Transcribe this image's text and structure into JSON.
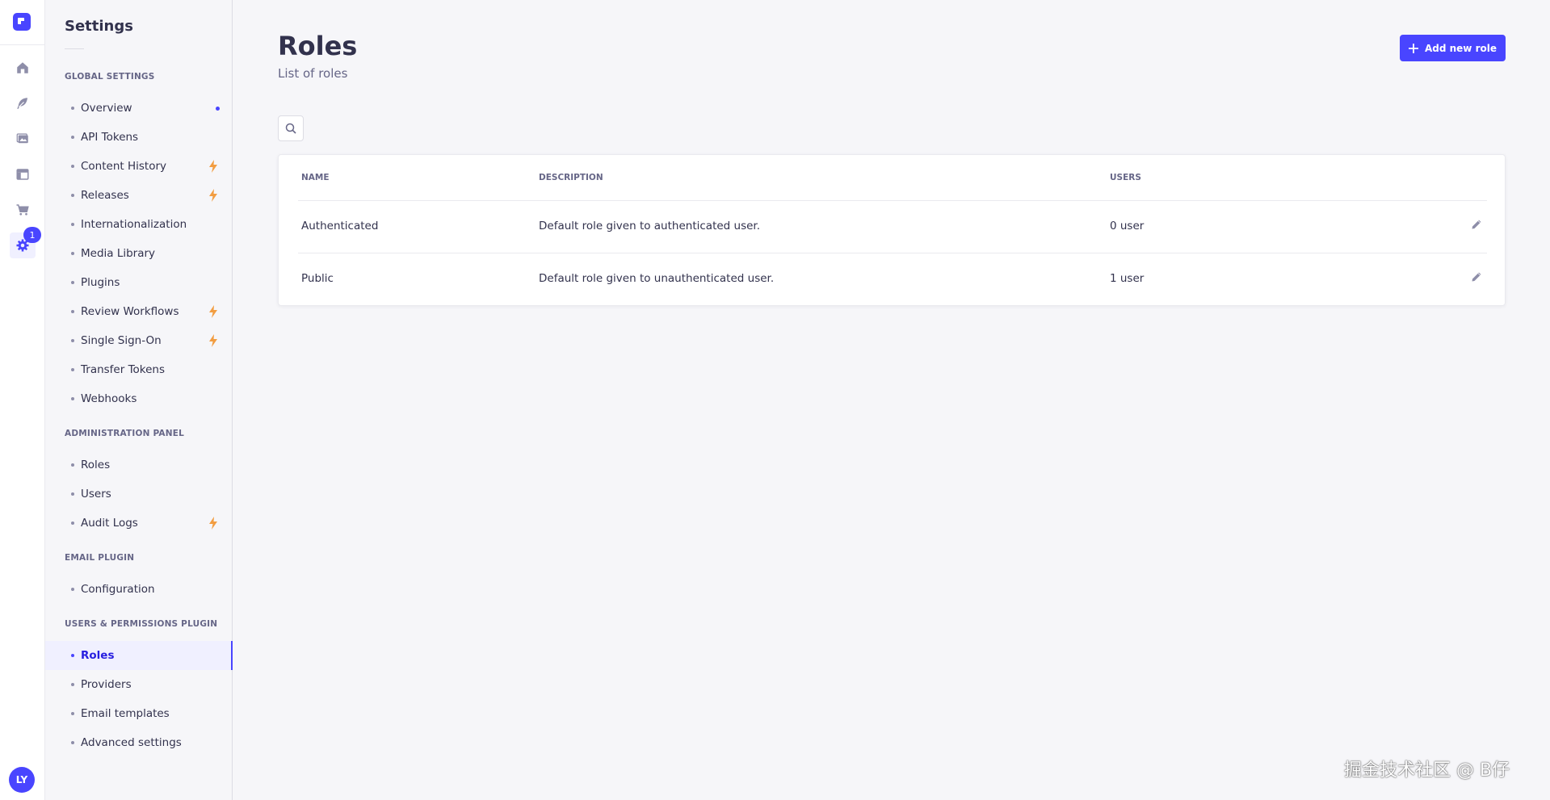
{
  "rail": {
    "badge": "1",
    "avatar": "LY",
    "icons": [
      "strapi-logo-icon",
      "home-icon",
      "feather-icon",
      "media-icon",
      "layout-icon",
      "cart-icon",
      "gear-icon"
    ]
  },
  "subnav": {
    "title": "Settings",
    "sections": [
      {
        "label": "GLOBAL SETTINGS",
        "items": [
          {
            "label": "Overview",
            "marker": "new-dot"
          },
          {
            "label": "API Tokens"
          },
          {
            "label": "Content History",
            "marker": "bolt"
          },
          {
            "label": "Releases",
            "marker": "bolt"
          },
          {
            "label": "Internationalization"
          },
          {
            "label": "Media Library"
          },
          {
            "label": "Plugins"
          },
          {
            "label": "Review Workflows",
            "marker": "bolt"
          },
          {
            "label": "Single Sign-On",
            "marker": "bolt"
          },
          {
            "label": "Transfer Tokens"
          },
          {
            "label": "Webhooks"
          }
        ]
      },
      {
        "label": "ADMINISTRATION PANEL",
        "items": [
          {
            "label": "Roles"
          },
          {
            "label": "Users"
          },
          {
            "label": "Audit Logs",
            "marker": "bolt"
          }
        ]
      },
      {
        "label": "EMAIL PLUGIN",
        "items": [
          {
            "label": "Configuration"
          }
        ]
      },
      {
        "label": "USERS & PERMISSIONS PLUGIN",
        "items": [
          {
            "label": "Roles",
            "active": true
          },
          {
            "label": "Providers"
          },
          {
            "label": "Email templates"
          },
          {
            "label": "Advanced settings"
          }
        ]
      }
    ]
  },
  "main": {
    "title": "Roles",
    "subtitle": "List of roles",
    "add_button_label": "Add new role",
    "table": {
      "headers": [
        "NAME",
        "DESCRIPTION",
        "USERS"
      ],
      "rows": [
        {
          "name": "Authenticated",
          "description": "Default role given to authenticated user.",
          "users": "0 user"
        },
        {
          "name": "Public",
          "description": "Default role given to unauthenticated user.",
          "users": "1 user"
        }
      ]
    }
  },
  "watermark": "掘金技术社区 @ B仔",
  "colors": {
    "primary": "#4945ff",
    "active_bg": "#f0f0ff",
    "bolt": "#f29d41",
    "text": "#32324d",
    "muted": "#666687"
  }
}
